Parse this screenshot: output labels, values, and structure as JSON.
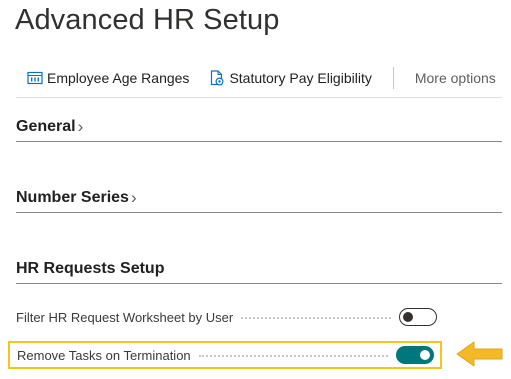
{
  "page": {
    "title": "Advanced HR Setup"
  },
  "actions": {
    "employee_age_ranges": "Employee Age Ranges",
    "statutory_pay_eligibility": "Statutory Pay Eligibility",
    "more_options": "More options"
  },
  "sections": {
    "general": {
      "label": "General",
      "chevron": "›"
    },
    "number_series": {
      "label": "Number Series",
      "chevron": "›"
    },
    "hr_requests_setup": {
      "label": "HR Requests Setup"
    }
  },
  "fields": {
    "filter_hr_request": {
      "label": "Filter HR Request Worksheet by User",
      "enabled": false
    },
    "remove_tasks": {
      "label": "Remove Tasks on Termination",
      "enabled": true
    }
  },
  "colors": {
    "accent_teal": "#00777c",
    "highlight": "#f5c518",
    "arrow": "#f5b829"
  },
  "icons": {
    "age_ranges": "table-icon",
    "statutory_pay": "document-gear-icon",
    "pointer": "arrow-left-icon"
  }
}
